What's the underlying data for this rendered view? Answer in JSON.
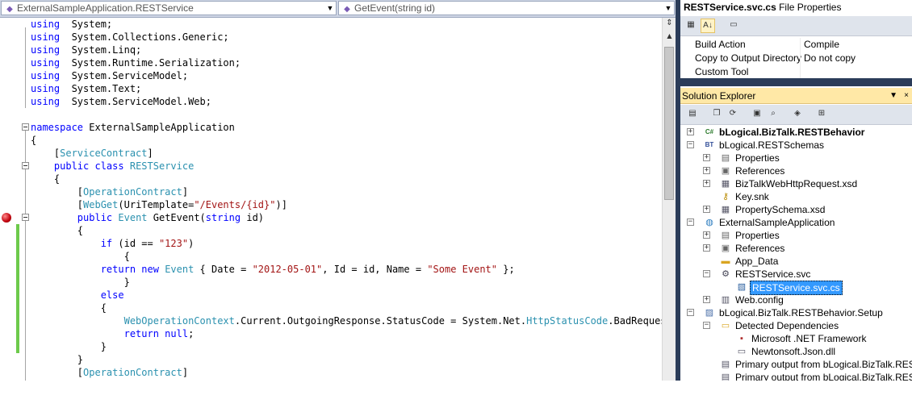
{
  "editor": {
    "type_combo": "ExternalSampleApplication.RESTService",
    "member_combo": "GetEvent(string id)",
    "lines": [
      [
        [
          "kw",
          "using"
        ],
        [
          "",
          "  System;"
        ]
      ],
      [
        [
          "kw",
          "using"
        ],
        [
          "",
          "  System.Collections.Generic;"
        ]
      ],
      [
        [
          "kw",
          "using"
        ],
        [
          "",
          "  System.Linq;"
        ]
      ],
      [
        [
          "kw",
          "using"
        ],
        [
          "",
          "  System.Runtime.Serialization;"
        ]
      ],
      [
        [
          "kw",
          "using"
        ],
        [
          "",
          "  System.ServiceModel;"
        ]
      ],
      [
        [
          "kw",
          "using"
        ],
        [
          "",
          "  System.Text;"
        ]
      ],
      [
        [
          "kw",
          "using"
        ],
        [
          "",
          "  System.ServiceModel.Web;"
        ]
      ],
      [],
      [
        [
          "kw",
          "namespace"
        ],
        [
          "",
          " ExternalSampleApplication"
        ]
      ],
      [
        [
          "",
          "{"
        ]
      ],
      [
        [
          "",
          "    ["
        ],
        [
          "ty",
          "ServiceContract"
        ],
        [
          "",
          "]"
        ]
      ],
      [
        [
          "",
          "    "
        ],
        [
          "kw",
          "public class"
        ],
        [
          "",
          " "
        ],
        [
          "ty",
          "RESTService"
        ]
      ],
      [
        [
          "",
          "    {"
        ]
      ],
      [
        [
          "",
          "        ["
        ],
        [
          "ty",
          "OperationContract"
        ],
        [
          "",
          "]"
        ]
      ],
      [
        [
          "",
          "        ["
        ],
        [
          "ty",
          "WebGet"
        ],
        [
          "",
          "(UriTemplate="
        ],
        [
          "st",
          "\"/Events/{id}\""
        ],
        [
          "",
          ")]"
        ]
      ],
      [
        [
          "",
          "        "
        ],
        [
          "kw",
          "public"
        ],
        [
          "",
          " "
        ],
        [
          "ty",
          "Event"
        ],
        [
          "",
          " GetEvent("
        ],
        [
          "kw",
          "string"
        ],
        [
          "",
          " id)"
        ]
      ],
      [
        [
          "",
          "        {"
        ]
      ],
      [
        [
          "",
          "            "
        ],
        [
          "kw",
          "if"
        ],
        [
          "",
          " (id == "
        ],
        [
          "st",
          "\"123\""
        ],
        [
          "",
          ")"
        ]
      ],
      [
        [
          "",
          "                {"
        ]
      ],
      [
        [
          "",
          "            "
        ],
        [
          "kw",
          "return new"
        ],
        [
          "",
          " "
        ],
        [
          "ty",
          "Event"
        ],
        [
          "",
          " { Date = "
        ],
        [
          "st",
          "\"2012-05-01\""
        ],
        [
          "",
          ", Id = id, Name = "
        ],
        [
          "st",
          "\"Some Event\""
        ],
        [
          "",
          " };"
        ]
      ],
      [
        [
          "",
          "                }"
        ]
      ],
      [
        [
          "",
          "            "
        ],
        [
          "kw",
          "else"
        ]
      ],
      [
        [
          "",
          "            {"
        ]
      ],
      [
        [
          "",
          "                "
        ],
        [
          "ty",
          "WebOperationContext"
        ],
        [
          "",
          ".Current.OutgoingResponse.StatusCode = System.Net."
        ],
        [
          "ty",
          "HttpStatusCode"
        ],
        [
          "",
          ".BadRequest;"
        ]
      ],
      [
        [
          "",
          "                "
        ],
        [
          "kw",
          "return null"
        ],
        [
          "",
          ";"
        ]
      ],
      [
        [
          "",
          "            }"
        ]
      ],
      [
        [
          "",
          "        }"
        ]
      ],
      [
        [
          "",
          "        ["
        ],
        [
          "ty",
          "OperationContract"
        ],
        [
          "",
          "]"
        ]
      ]
    ]
  },
  "properties": {
    "title_bold": "RESTService.svc.cs",
    "title_rest": " File Properties",
    "rows": [
      {
        "key": "Build Action",
        "value": "Compile"
      },
      {
        "key": "Copy to Output Directory",
        "value": "Do not copy"
      },
      {
        "key": "Custom Tool",
        "value": ""
      }
    ]
  },
  "solution_explorer": {
    "title": "Solution Explorer",
    "pin_glyph": "▼",
    "close_glyph": "×",
    "nodes": [
      {
        "label": "bLogical.BizTalk.RESTBehavior",
        "level": 0,
        "expander": "+",
        "icon": "project-cs-icon",
        "glyph": "C#",
        "color": "#2b7a2b",
        "bold": true
      },
      {
        "label": "bLogical.RESTSchemas",
        "level": 0,
        "expander": "-",
        "icon": "project-bt-icon",
        "glyph": "BT",
        "color": "#334f99"
      },
      {
        "label": "Properties",
        "level": 1,
        "expander": "+",
        "icon": "properties-icon",
        "glyph": "▤",
        "color": "#666"
      },
      {
        "label": "References",
        "level": 1,
        "expander": "+",
        "icon": "references-icon",
        "glyph": "▣",
        "color": "#666"
      },
      {
        "label": "BizTalkWebHttpRequest.xsd",
        "level": 1,
        "expander": "+",
        "icon": "xsd-file-icon",
        "glyph": "▦",
        "color": "#556"
      },
      {
        "label": "Key.snk",
        "level": 1,
        "expander": "",
        "icon": "key-file-icon",
        "glyph": "⚷",
        "color": "#b88a00"
      },
      {
        "label": "PropertySchema.xsd",
        "level": 1,
        "expander": "+",
        "icon": "xsd-file-icon",
        "glyph": "▦",
        "color": "#556"
      },
      {
        "label": "ExternalSampleApplication",
        "level": 0,
        "expander": "-",
        "icon": "web-project-icon",
        "glyph": "◍",
        "color": "#2a7bbf"
      },
      {
        "label": "Properties",
        "level": 1,
        "expander": "+",
        "icon": "properties-icon",
        "glyph": "▤",
        "color": "#666"
      },
      {
        "label": "References",
        "level": 1,
        "expander": "+",
        "icon": "references-icon",
        "glyph": "▣",
        "color": "#666"
      },
      {
        "label": "App_Data",
        "level": 1,
        "expander": "",
        "icon": "folder-icon",
        "glyph": "▬",
        "color": "#d9a520"
      },
      {
        "label": "RESTService.svc",
        "level": 1,
        "expander": "-",
        "icon": "svc-file-icon",
        "glyph": "⚙",
        "color": "#445"
      },
      {
        "label": "RESTService.svc.cs",
        "level": 2,
        "expander": "",
        "icon": "cs-file-icon",
        "glyph": "▧",
        "color": "#2b5f9e",
        "selected": true
      },
      {
        "label": "Web.config",
        "level": 1,
        "expander": "+",
        "icon": "config-file-icon",
        "glyph": "▥",
        "color": "#556"
      },
      {
        "label": "bLogical.BizTalk.RESTBehavior.Setup",
        "level": 0,
        "expander": "-",
        "icon": "setup-project-icon",
        "glyph": "▨",
        "color": "#4a6fa8"
      },
      {
        "label": "Detected Dependencies",
        "level": 1,
        "expander": "-",
        "icon": "open-folder-icon",
        "glyph": "▭",
        "color": "#d9a520"
      },
      {
        "label": "Microsoft .NET Framework",
        "level": 2,
        "expander": "",
        "icon": "dependency-icon",
        "glyph": "▪",
        "color": "#b03030"
      },
      {
        "label": "Newtonsoft.Json.dll",
        "level": 2,
        "expander": "",
        "icon": "dll-icon",
        "glyph": "▭",
        "color": "#556"
      },
      {
        "label": "Primary output from bLogical.BizTalk.RESTBeh",
        "level": 1,
        "expander": "",
        "icon": "output-icon",
        "glyph": "▤",
        "color": "#556"
      },
      {
        "label": "Primary output from bLogical.BizTalk.RESTBeh",
        "level": 1,
        "expander": "",
        "icon": "output-icon",
        "glyph": "▤",
        "color": "#556"
      }
    ]
  }
}
